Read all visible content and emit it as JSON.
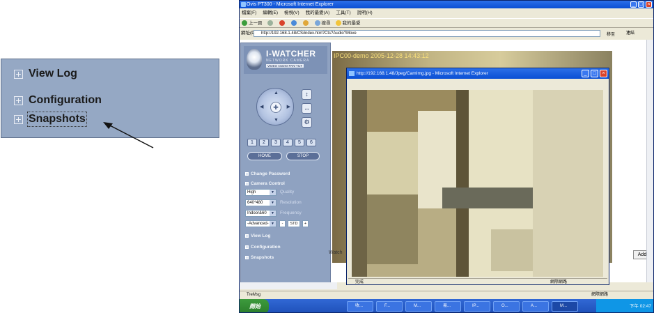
{
  "zoom_menu": {
    "items": [
      {
        "label": "View Log"
      },
      {
        "label": "Configuration"
      },
      {
        "label": "Snapshots"
      }
    ]
  },
  "browser": {
    "title": "Ovis PT300 - Microsoft Internet Explorer",
    "menu": [
      "檔案(F)",
      "編輯(E)",
      "檢視(V)",
      "我的最愛(A)",
      "工具(T)",
      "說明(H)"
    ],
    "toolbar": [
      "上一頁",
      "搜尋",
      "我的最愛"
    ],
    "address_label": "網址(D)",
    "address": "http://192.168.1.48/CS/index.htm?Cts?Audio?Move",
    "go_label": "移至",
    "links_label": "連結",
    "status": "TreMsg",
    "status_right": "網際網路"
  },
  "cam_panel": {
    "logo_title": "I-WATCHER",
    "logo_sub": "NETWORK CAMERA",
    "logo_tag": "VIDEO AUDIO PAN-TILT",
    "presets": [
      "1",
      "2",
      "3",
      "4",
      "5",
      "6"
    ],
    "home_label": "HOME",
    "stop_label": "STOP",
    "change_password": "Change Password",
    "camera_control": "Camera Control",
    "quality_value": "High",
    "quality_label": "Quality",
    "resolution_value": "640*480",
    "resolution_label": "Resolution",
    "frequency_value": "Indoor&60",
    "frequency_label": "Frequency",
    "advanced_value": "-Advanced-",
    "advanced_minus": "-",
    "advanced_std": "STD",
    "advanced_plus": "+",
    "view_log": "View Log",
    "configuration": "Configuration",
    "snapshots": "Snapshots"
  },
  "feed": {
    "timestamp": "IPC00-demo 2005-12-28 14:43:12",
    "watch_label": "Watch",
    "add_label": "Add"
  },
  "popup": {
    "title": "http://192.168.1.48/Jpeg/CamImg.jpg - Microsoft Internet Explorer",
    "status_left": "完成",
    "status_right": "網際網路"
  },
  "taskbar": {
    "start": "開始",
    "items": [
      "收...",
      "F...",
      "M...",
      "易...",
      "IP...",
      "O...",
      "A...",
      "M..."
    ],
    "clock": "下午 02:47"
  }
}
